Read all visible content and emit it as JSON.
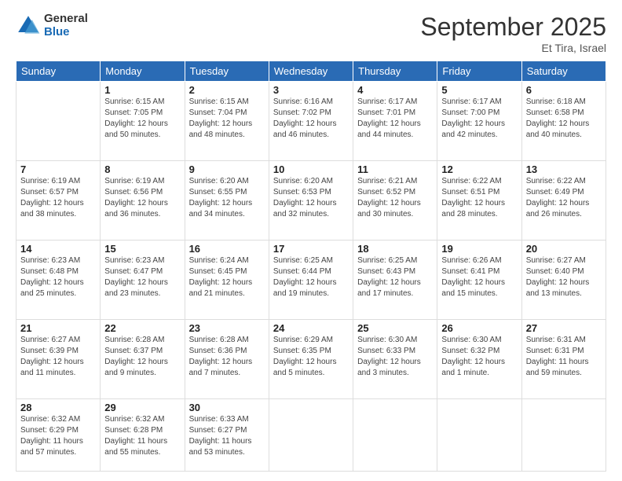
{
  "logo": {
    "general": "General",
    "blue": "Blue"
  },
  "header": {
    "month": "September 2025",
    "location": "Et Tira, Israel"
  },
  "weekdays": [
    "Sunday",
    "Monday",
    "Tuesday",
    "Wednesday",
    "Thursday",
    "Friday",
    "Saturday"
  ],
  "weeks": [
    [
      {
        "day": "",
        "sunrise": "",
        "sunset": "",
        "daylight": ""
      },
      {
        "day": "1",
        "sunrise": "6:15 AM",
        "sunset": "7:05 PM",
        "daylight": "12 hours and 50 minutes."
      },
      {
        "day": "2",
        "sunrise": "6:15 AM",
        "sunset": "7:04 PM",
        "daylight": "12 hours and 48 minutes."
      },
      {
        "day": "3",
        "sunrise": "6:16 AM",
        "sunset": "7:02 PM",
        "daylight": "12 hours and 46 minutes."
      },
      {
        "day": "4",
        "sunrise": "6:17 AM",
        "sunset": "7:01 PM",
        "daylight": "12 hours and 44 minutes."
      },
      {
        "day": "5",
        "sunrise": "6:17 AM",
        "sunset": "7:00 PM",
        "daylight": "12 hours and 42 minutes."
      },
      {
        "day": "6",
        "sunrise": "6:18 AM",
        "sunset": "6:58 PM",
        "daylight": "12 hours and 40 minutes."
      }
    ],
    [
      {
        "day": "7",
        "sunrise": "6:19 AM",
        "sunset": "6:57 PM",
        "daylight": "12 hours and 38 minutes."
      },
      {
        "day": "8",
        "sunrise": "6:19 AM",
        "sunset": "6:56 PM",
        "daylight": "12 hours and 36 minutes."
      },
      {
        "day": "9",
        "sunrise": "6:20 AM",
        "sunset": "6:55 PM",
        "daylight": "12 hours and 34 minutes."
      },
      {
        "day": "10",
        "sunrise": "6:20 AM",
        "sunset": "6:53 PM",
        "daylight": "12 hours and 32 minutes."
      },
      {
        "day": "11",
        "sunrise": "6:21 AM",
        "sunset": "6:52 PM",
        "daylight": "12 hours and 30 minutes."
      },
      {
        "day": "12",
        "sunrise": "6:22 AM",
        "sunset": "6:51 PM",
        "daylight": "12 hours and 28 minutes."
      },
      {
        "day": "13",
        "sunrise": "6:22 AM",
        "sunset": "6:49 PM",
        "daylight": "12 hours and 26 minutes."
      }
    ],
    [
      {
        "day": "14",
        "sunrise": "6:23 AM",
        "sunset": "6:48 PM",
        "daylight": "12 hours and 25 minutes."
      },
      {
        "day": "15",
        "sunrise": "6:23 AM",
        "sunset": "6:47 PM",
        "daylight": "12 hours and 23 minutes."
      },
      {
        "day": "16",
        "sunrise": "6:24 AM",
        "sunset": "6:45 PM",
        "daylight": "12 hours and 21 minutes."
      },
      {
        "day": "17",
        "sunrise": "6:25 AM",
        "sunset": "6:44 PM",
        "daylight": "12 hours and 19 minutes."
      },
      {
        "day": "18",
        "sunrise": "6:25 AM",
        "sunset": "6:43 PM",
        "daylight": "12 hours and 17 minutes."
      },
      {
        "day": "19",
        "sunrise": "6:26 AM",
        "sunset": "6:41 PM",
        "daylight": "12 hours and 15 minutes."
      },
      {
        "day": "20",
        "sunrise": "6:27 AM",
        "sunset": "6:40 PM",
        "daylight": "12 hours and 13 minutes."
      }
    ],
    [
      {
        "day": "21",
        "sunrise": "6:27 AM",
        "sunset": "6:39 PM",
        "daylight": "12 hours and 11 minutes."
      },
      {
        "day": "22",
        "sunrise": "6:28 AM",
        "sunset": "6:37 PM",
        "daylight": "12 hours and 9 minutes."
      },
      {
        "day": "23",
        "sunrise": "6:28 AM",
        "sunset": "6:36 PM",
        "daylight": "12 hours and 7 minutes."
      },
      {
        "day": "24",
        "sunrise": "6:29 AM",
        "sunset": "6:35 PM",
        "daylight": "12 hours and 5 minutes."
      },
      {
        "day": "25",
        "sunrise": "6:30 AM",
        "sunset": "6:33 PM",
        "daylight": "12 hours and 3 minutes."
      },
      {
        "day": "26",
        "sunrise": "6:30 AM",
        "sunset": "6:32 PM",
        "daylight": "12 hours and 1 minute."
      },
      {
        "day": "27",
        "sunrise": "6:31 AM",
        "sunset": "6:31 PM",
        "daylight": "11 hours and 59 minutes."
      }
    ],
    [
      {
        "day": "28",
        "sunrise": "6:32 AM",
        "sunset": "6:29 PM",
        "daylight": "11 hours and 57 minutes."
      },
      {
        "day": "29",
        "sunrise": "6:32 AM",
        "sunset": "6:28 PM",
        "daylight": "11 hours and 55 minutes."
      },
      {
        "day": "30",
        "sunrise": "6:33 AM",
        "sunset": "6:27 PM",
        "daylight": "11 hours and 53 minutes."
      },
      {
        "day": "",
        "sunrise": "",
        "sunset": "",
        "daylight": ""
      },
      {
        "day": "",
        "sunrise": "",
        "sunset": "",
        "daylight": ""
      },
      {
        "day": "",
        "sunrise": "",
        "sunset": "",
        "daylight": ""
      },
      {
        "day": "",
        "sunrise": "",
        "sunset": "",
        "daylight": ""
      }
    ]
  ]
}
